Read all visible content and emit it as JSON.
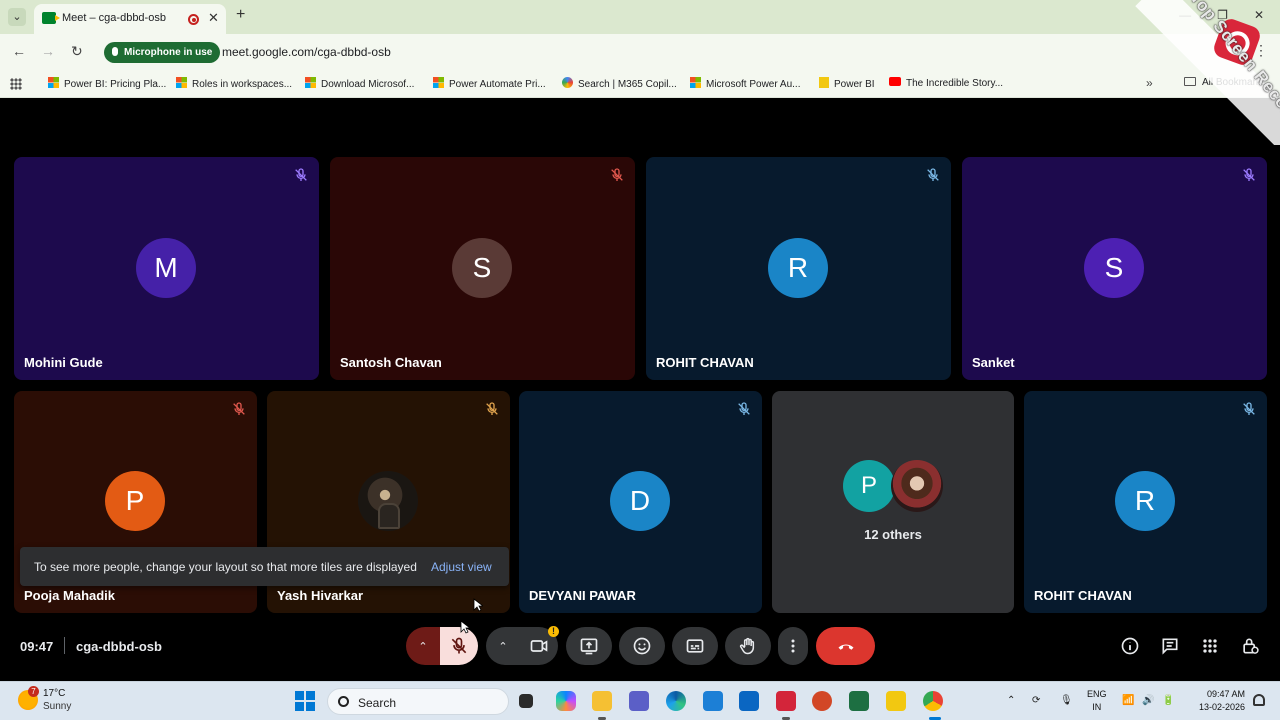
{
  "browser": {
    "tab_title": "Meet – cga-dbbd-osb",
    "mic_pill": "Microphone in use",
    "url": "meet.google.com/cga-dbbd-osb",
    "bookmarks": [
      {
        "label": "Power BI: Pricing Pla...",
        "icon": "ms"
      },
      {
        "label": "Roles in workspaces...",
        "icon": "ms"
      },
      {
        "label": "Download Microsof...",
        "icon": "ms"
      },
      {
        "label": "Power Automate Pri...",
        "icon": "ms"
      },
      {
        "label": "Search | M365 Copil...",
        "icon": "circle"
      },
      {
        "label": "Microsoft Power Au...",
        "icon": "ms"
      },
      {
        "label": "Power BI",
        "icon": "pbi"
      },
      {
        "label": "The Incredible Story...",
        "icon": "yt"
      }
    ],
    "all_bookmarks": "All Bookmarks"
  },
  "watermark": {
    "text": "iTop Screen Recorder"
  },
  "tiles": [
    {
      "name": "Mohini Gude",
      "initial": "M",
      "bg": "#1d0a4d",
      "avatar_color": "#4521a8",
      "mic_color": "#9c7bff"
    },
    {
      "name": "Santosh Chavan",
      "initial": "S",
      "bg": "#2a0706",
      "avatar_color": "#5a3a36",
      "mic_color": "#e0584e"
    },
    {
      "name": "ROHIT CHAVAN",
      "initial": "R",
      "bg": "#071a2d",
      "avatar_color": "#1a85c7",
      "mic_color": "#7ab8e6"
    },
    {
      "name": "Sanket",
      "initial": "S",
      "bg": "#1d0a4d",
      "avatar_color": "#4d20b3",
      "mic_color": "#9c7bff"
    },
    {
      "name": "Pooja Mahadik",
      "initial": "P",
      "bg": "#2b0d05",
      "avatar_color": "#e35b14",
      "mic_color": "#e0584e"
    },
    {
      "name": "Yash Hivarkar",
      "initial": "",
      "bg": "#241204",
      "avatar_color": "#3c3128",
      "mic_color": "#e0a34e"
    },
    {
      "name": "DEVYANI PAWAR",
      "initial": "D",
      "bg": "#071a2d",
      "avatar_color": "#1a85c7",
      "mic_color": "#7ab8e6"
    },
    {
      "name": "ROHIT CHAVAN",
      "initial": "R",
      "bg": "#071a2d",
      "avatar_color": "#1a85c7",
      "mic_color": "#7ab8e6"
    }
  ],
  "others": {
    "initial": "P",
    "label": "12 others"
  },
  "toast": {
    "message": "To see more people, change your layout so that more tiles are displayed",
    "action": "Adjust view"
  },
  "meeting": {
    "time": "09:47",
    "code": "cga-dbbd-osb"
  },
  "controls": {
    "warn_badge": "!"
  },
  "taskbar": {
    "weather_badge": "7",
    "temperature": "17°C",
    "condition": "Sunny",
    "search": "Search",
    "lang_line1": "ENG",
    "lang_line2": "IN",
    "time": "09:47 AM",
    "date": "13-02-2026"
  },
  "colors": {
    "end_call": "#dc362e",
    "mute_active": "#f9dedc",
    "accent_link": "#8ab4f8"
  }
}
